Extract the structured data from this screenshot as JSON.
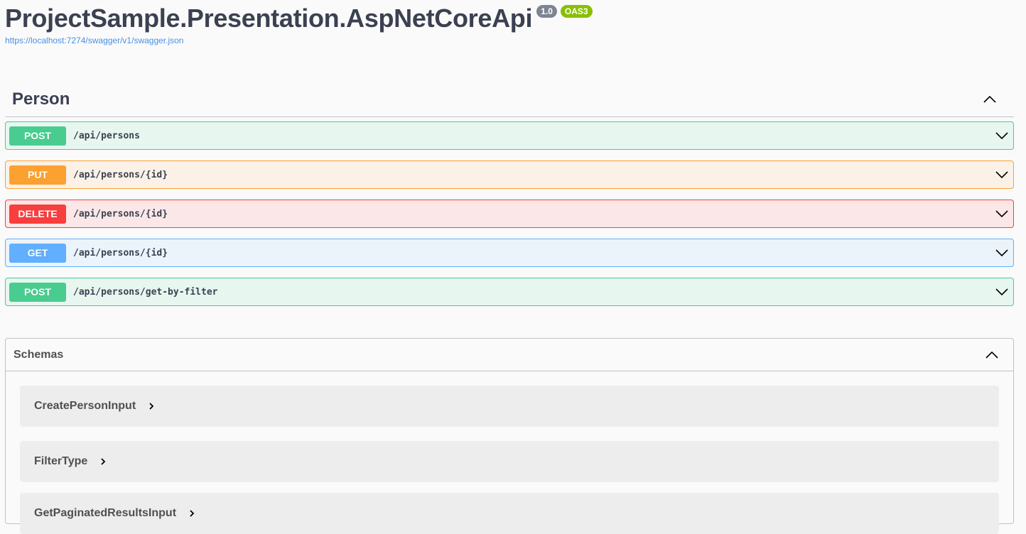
{
  "info": {
    "title": "ProjectSample.Presentation.AspNetCoreApi",
    "version": "1.0",
    "oas": "OAS3",
    "url": "https://localhost:7274/swagger/v1/swagger.json"
  },
  "tag": {
    "name": "Person",
    "icon": "chevron-up-icon"
  },
  "operations": [
    {
      "method": "POST",
      "path": "/api/persons",
      "color": "#49cc90",
      "bg": "#e8f6f0"
    },
    {
      "method": "PUT",
      "path": "/api/persons/{id}",
      "color": "#fca130",
      "bg": "#fbf1e6"
    },
    {
      "method": "DELETE",
      "path": "/api/persons/{id}",
      "color": "#f93e3e",
      "bg": "#fbe7e7"
    },
    {
      "method": "GET",
      "path": "/api/persons/{id}",
      "color": "#61affe",
      "bg": "#ebf3fb"
    },
    {
      "method": "POST",
      "path": "/api/persons/get-by-filter",
      "color": "#49cc90",
      "bg": "#e8f6f0"
    }
  ],
  "schemas": {
    "title": "Schemas",
    "models": [
      {
        "name": "CreatePersonInput"
      },
      {
        "name": "FilterType"
      },
      {
        "name": "GetPaginatedResultsInput"
      }
    ]
  }
}
